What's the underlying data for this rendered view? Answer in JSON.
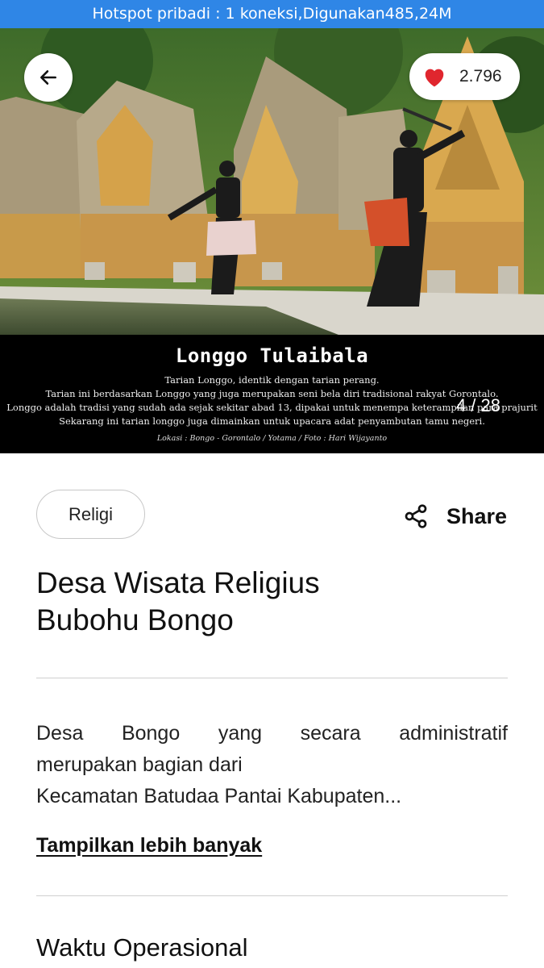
{
  "status_bar": {
    "text": "Hotspot pribadi : 1 koneksi,Digunakan485,24M"
  },
  "gallery": {
    "caption_title": "Longgo Tulaibala",
    "caption_lines": [
      "Tarian Longgo, identik dengan tarian perang.",
      "Tarian ini berdasarkan Longgo yang juga merupakan seni bela diri tradisional rakyat Gorontalo.",
      "Longgo adalah tradisi yang sudah ada sejak sekitar abad 13,  dipakai untuk menempa keterampilan para prajurit",
      "Sekarang ini tarian longgo juga dimainkan untuk upacara adat penyambutan tamu negeri."
    ],
    "caption_credit": "Lokasi : Bongo - Gorontalo / Yotama / Foto : Hari Wijayanto",
    "counter": "4 / 28",
    "like_count": "2.796",
    "colors": {
      "heart": "#e0262e"
    }
  },
  "detail": {
    "tag": "Religi",
    "share_label": "Share",
    "title_line1": "Desa Wisata Religius",
    "title_line2": "Bubohu Bongo",
    "desc_line1": "Desa Bongo yang secara administratif",
    "desc_line2": "merupakan bagian dari",
    "desc_line3": "Kecamatan Batudaa Pantai Kabupaten...",
    "more_link": "Tampilkan lebih banyak",
    "section_title": "Waktu Operasional"
  },
  "icons": {
    "back": "arrow-left-icon",
    "like": "heart-icon",
    "share": "share-icon"
  }
}
